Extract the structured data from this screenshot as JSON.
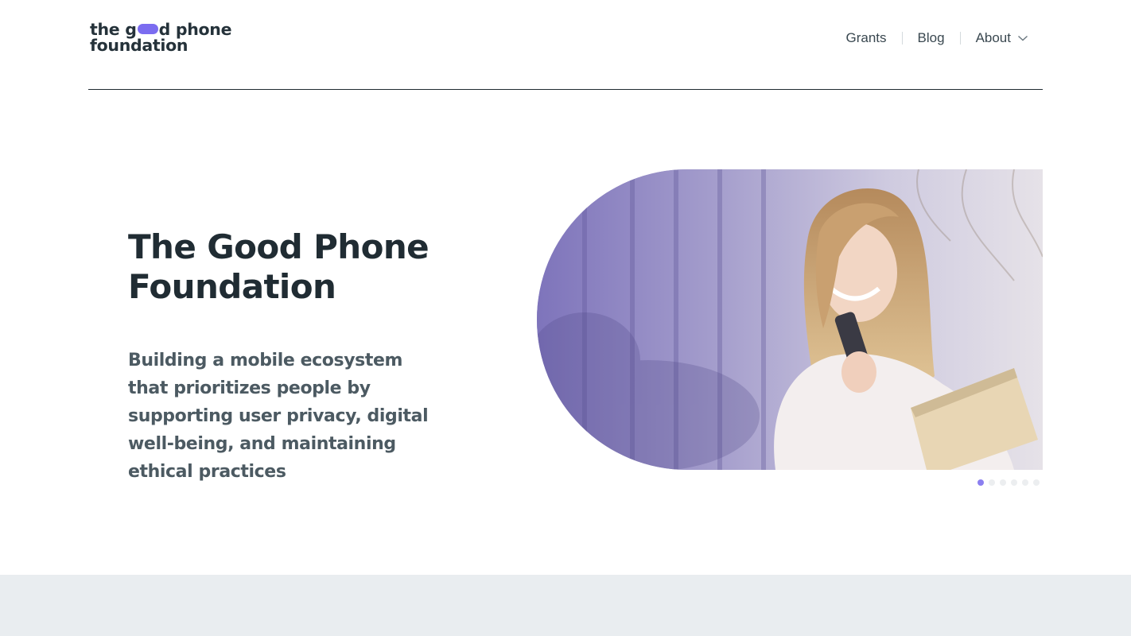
{
  "brand": {
    "logo_line1_a": "the g",
    "logo_line1_b": "d phone",
    "logo_line2": "foundation",
    "accent_color": "#7b6cf0"
  },
  "nav": {
    "items": [
      {
        "label": "Grants"
      },
      {
        "label": "Blog"
      },
      {
        "label": "About"
      }
    ]
  },
  "hero": {
    "title": "The Good Phone Foundation",
    "subtitle": "Building a mobile ecosystem that prioritizes people by supporting user privacy, digital well-being, and maintaining ethical practices",
    "image_icon": "woman-with-phone-photo"
  },
  "carousel": {
    "slide_count": 6,
    "active_index": 0
  },
  "colors": {
    "heading": "#202c33",
    "subtitle": "#4c5a62",
    "footer_band": "#e9edf0",
    "dot_active": "#8b7ff0"
  }
}
